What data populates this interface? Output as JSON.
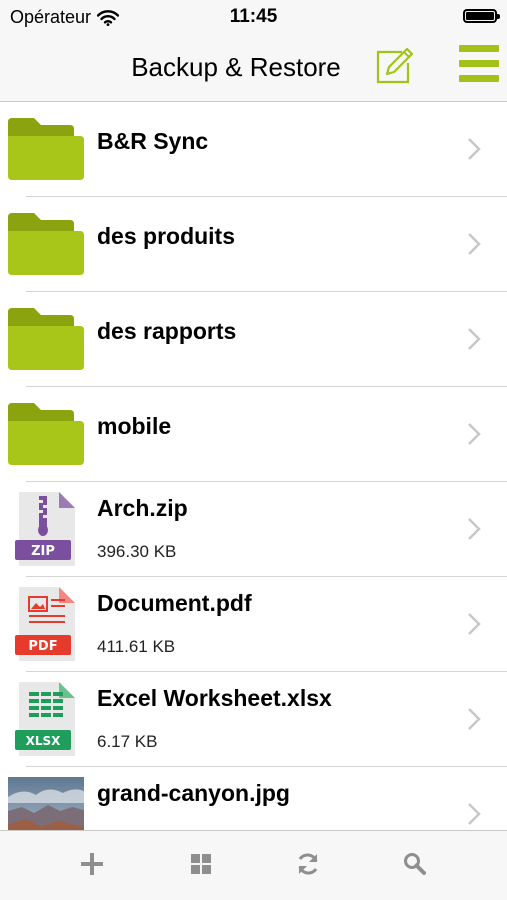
{
  "status_bar": {
    "carrier": "Opérateur",
    "time": "11:45"
  },
  "nav": {
    "title": "Backup & Restore"
  },
  "colors": {
    "accent": "#a2c21a",
    "folder": "#a8c51a",
    "folder_dark": "#8ca310",
    "zip": "#7b4f9e",
    "pdf": "#e53a2c",
    "xlsx": "#1e9e5a",
    "chevron": "#c7c7cc",
    "toolbar_icon": "#8e8e8e"
  },
  "files": [
    {
      "name": "B&R Sync",
      "type": "folder",
      "icon": "folder-icon"
    },
    {
      "name": "des produits",
      "type": "folder",
      "icon": "folder-icon"
    },
    {
      "name": "des rapports",
      "type": "folder",
      "icon": "folder-icon"
    },
    {
      "name": "mobile",
      "type": "folder",
      "icon": "folder-icon"
    },
    {
      "name": "Arch.zip",
      "type": "zip",
      "size": "396.30 KB",
      "badge": "ZIP",
      "icon": "zip-file-icon"
    },
    {
      "name": "Document.pdf",
      "type": "pdf",
      "size": "411.61 KB",
      "badge": "PDF",
      "icon": "pdf-file-icon"
    },
    {
      "name": "Excel Worksheet.xlsx",
      "type": "xlsx",
      "size": "6.17 KB",
      "badge": "XLSX",
      "icon": "xlsx-file-icon"
    },
    {
      "name": "grand-canyon.jpg",
      "type": "image",
      "icon": "image-thumbnail-icon"
    }
  ],
  "toolbar": {
    "add_icon": "plus-icon",
    "grid_icon": "grid-icon",
    "sync_icon": "sync-icon",
    "search_icon": "search-icon"
  }
}
